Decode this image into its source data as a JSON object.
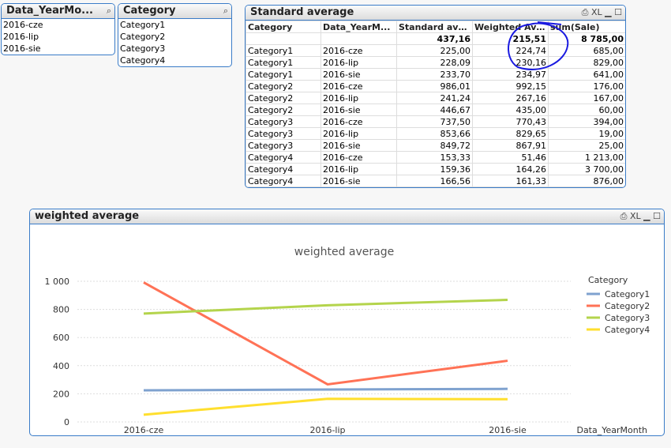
{
  "listbox1": {
    "title": "Data_YearMo...",
    "items": [
      "2016-cze",
      "2016-lip",
      "2016-sie"
    ]
  },
  "listbox2": {
    "title": "Category",
    "items": [
      "Category1",
      "Category2",
      "Category3",
      "Category4"
    ]
  },
  "table": {
    "title": "Standard average",
    "headers": [
      "Category",
      "Data_YearM...",
      "Standard ave...",
      "Weighted Ave...",
      "sum(Sale)"
    ],
    "totals": [
      "",
      "",
      "437,16",
      "215,51",
      "8 785,00"
    ],
    "rows": [
      [
        "Category1",
        "2016-cze",
        "225,00",
        "224,74",
        "685,00"
      ],
      [
        "Category1",
        "2016-lip",
        "228,09",
        "230,16",
        "829,00"
      ],
      [
        "Category1",
        "2016-sie",
        "233,70",
        "234,97",
        "641,00"
      ],
      [
        "Category2",
        "2016-cze",
        "986,01",
        "992,15",
        "176,00"
      ],
      [
        "Category2",
        "2016-lip",
        "241,24",
        "267,16",
        "167,00"
      ],
      [
        "Category2",
        "2016-sie",
        "446,67",
        "435,00",
        "60,00"
      ],
      [
        "Category3",
        "2016-cze",
        "737,50",
        "770,43",
        "394,00"
      ],
      [
        "Category3",
        "2016-lip",
        "853,66",
        "829,65",
        "19,00"
      ],
      [
        "Category3",
        "2016-sie",
        "849,72",
        "867,91",
        "25,00"
      ],
      [
        "Category4",
        "2016-cze",
        "153,33",
        "51,46",
        "1 213,00"
      ],
      [
        "Category4",
        "2016-lip",
        "159,36",
        "164,26",
        "3 700,00"
      ],
      [
        "Category4",
        "2016-sie",
        "166,56",
        "161,33",
        "876,00"
      ]
    ]
  },
  "chart_box": {
    "title": "weighted average"
  },
  "chart_data": {
    "type": "line",
    "title": "weighted average",
    "xlabel": "Data_YearMonth",
    "ylabel": "",
    "legend_title": "Category",
    "legend_position": "right",
    "categories": [
      "2016-cze",
      "2016-lip",
      "2016-sie"
    ],
    "ylim": [
      0,
      1000
    ],
    "yticks": [
      0,
      200,
      400,
      600,
      800,
      1000
    ],
    "ytick_labels": [
      "0",
      "200",
      "400",
      "600",
      "800",
      "1 000"
    ],
    "series": [
      {
        "name": "Category1",
        "color": "#7fa2cf",
        "values": [
          224.74,
          230.16,
          234.97
        ]
      },
      {
        "name": "Category2",
        "color": "#ff7256",
        "values": [
          992.15,
          267.16,
          435.0
        ]
      },
      {
        "name": "Category3",
        "color": "#b4d44c",
        "values": [
          770.43,
          829.65,
          867.91
        ]
      },
      {
        "name": "Category4",
        "color": "#ffdf2e",
        "values": [
          51.46,
          164.26,
          161.33
        ]
      }
    ]
  }
}
